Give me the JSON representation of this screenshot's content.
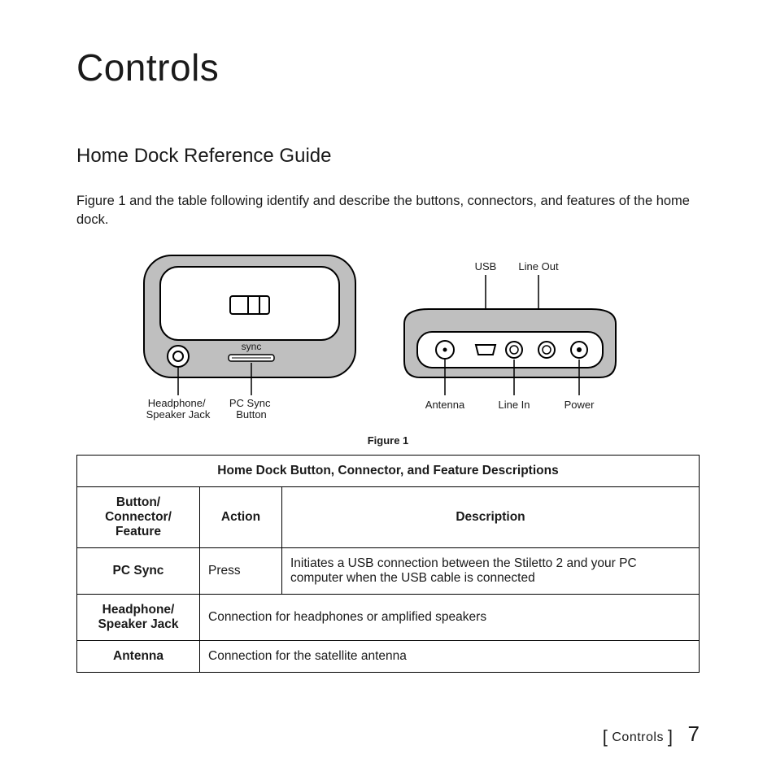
{
  "title": "Controls",
  "section": "Home Dock Reference Guide",
  "intro": "Figure 1 and the table following identify and describe the buttons, connectors, and features of the home dock.",
  "figure": {
    "caption": "Figure 1",
    "front": {
      "sync_label": "sync",
      "callouts": {
        "headphone": {
          "line1": "Headphone/",
          "line2": "Speaker Jack"
        },
        "pcsync": {
          "line1": "PC Sync",
          "line2": "Button"
        }
      }
    },
    "back": {
      "top_labels": {
        "usb": "USB",
        "lineout": "Line Out"
      },
      "bottom_labels": {
        "antenna": "Antenna",
        "linein": "Line In",
        "power": "Power"
      }
    }
  },
  "table": {
    "title": "Home Dock Button, Connector, and Feature Descriptions",
    "headers": {
      "col1": "Button/\nConnector/\nFeature",
      "col2": "Action",
      "col3": "Description"
    },
    "rows": [
      {
        "name": "PC Sync",
        "action": "Press",
        "desc": "Initiates a USB connection between the Stiletto 2 and your PC computer when the USB cable is connected"
      },
      {
        "name": "Headphone/\nSpeaker Jack",
        "desc": "Connection for headphones or amplified speakers"
      },
      {
        "name": "Antenna",
        "desc": "Connection for the satellite antenna"
      }
    ]
  },
  "footer": {
    "section": "Controls",
    "page": "7"
  }
}
